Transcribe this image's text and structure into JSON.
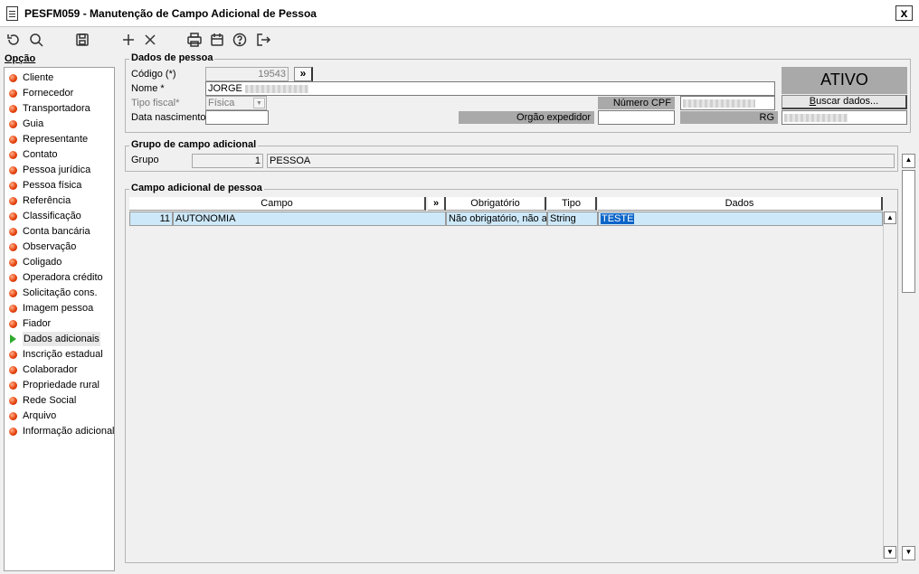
{
  "window": {
    "title": "PESFM059 - Manutenção de Campo Adicional de Pessoa",
    "close_label": "x"
  },
  "toolbar": {
    "icons": [
      "undo-icon",
      "search-icon",
      "save-icon",
      "add-icon",
      "delete-icon",
      "print-icon",
      "calendar-icon",
      "help-icon",
      "exit-icon"
    ]
  },
  "nav": {
    "heading": "Opção",
    "items": [
      {
        "label": "Cliente"
      },
      {
        "label": "Fornecedor"
      },
      {
        "label": "Transportadora"
      },
      {
        "label": "Guia"
      },
      {
        "label": "Representante"
      },
      {
        "label": "Contato"
      },
      {
        "label": "Pessoa jurídica"
      },
      {
        "label": "Pessoa física"
      },
      {
        "label": "Referência"
      },
      {
        "label": "Classificação"
      },
      {
        "label": "Conta bancária"
      },
      {
        "label": "Observação"
      },
      {
        "label": "Coligado"
      },
      {
        "label": "Operadora crédito"
      },
      {
        "label": "Solicitação cons."
      },
      {
        "label": "Imagem pessoa"
      },
      {
        "label": "Fiador"
      },
      {
        "label": "Dados adicionais"
      },
      {
        "label": "Inscrição estadual"
      },
      {
        "label": "Colaborador"
      },
      {
        "label": "Propriedade rural"
      },
      {
        "label": "Rede Social"
      },
      {
        "label": "Arquivo"
      },
      {
        "label": "Informação adicional"
      }
    ],
    "active_index": 17
  },
  "pessoa": {
    "section_title": "Dados de pessoa",
    "codigo_label": "Código (*)",
    "codigo_value": "19543",
    "chevron": "»",
    "nome_label": "Nome *",
    "nome_value": "JORGE",
    "tipo_fiscal_label": "Tipo fiscal*",
    "tipo_fiscal_value": "Física",
    "data_nasc_label": "Data nascimento",
    "data_nasc_value": "",
    "cpf_label": "Número CPF",
    "orgao_label": "Orgão expedidor",
    "orgao_value": "",
    "rg_label": "RG",
    "status": "ATIVO",
    "buscar_label": "Buscar dados...",
    "buscar_underline": "B",
    "buscar_rest": "uscar dados..."
  },
  "grupo": {
    "section_title": "Grupo de campo adicional",
    "label": "Grupo",
    "code": "1",
    "name": "PESSOA"
  },
  "campo": {
    "section_title": "Campo adicional de pessoa",
    "columns": [
      "Campo",
      "»",
      "Obrigatório",
      "Tipo",
      "Dados"
    ],
    "rows": [
      {
        "id": "11",
        "campo": "AUTONOMIA",
        "obrigatorio": "Não obrigatório, não a",
        "tipo": "String",
        "dados": "TESTE"
      }
    ]
  }
}
